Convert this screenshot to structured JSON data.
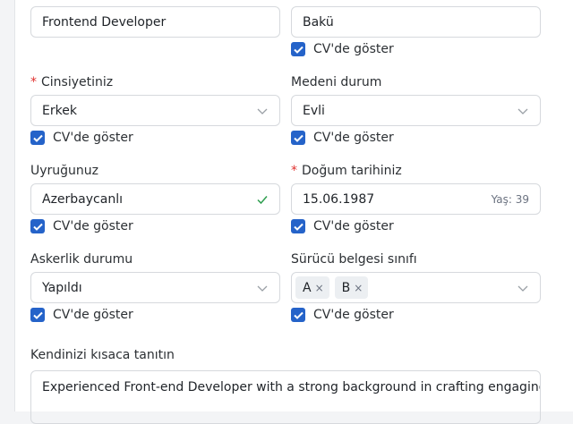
{
  "row1": {
    "left": {
      "value": "Frontend Developer"
    },
    "right": {
      "value": "Bakü",
      "show_cv": "CV'de göster"
    }
  },
  "gender": {
    "label": "Cinsiyetiniz",
    "required_mark": "*",
    "value": "Erkek",
    "show_cv": "CV'de göster"
  },
  "marital": {
    "label": "Medeni durum",
    "value": "Evli",
    "show_cv": "CV'de göster"
  },
  "nationality": {
    "label": "Uyruğunuz",
    "value": "Azerbaycanlı",
    "show_cv": "CV'de göster"
  },
  "birthdate": {
    "label": "Doğum tarihiniz",
    "required_mark": "*",
    "value": "15.06.1987",
    "age": "Yaş: 39",
    "show_cv": "CV'de göster"
  },
  "military": {
    "label": "Askerlik durumu",
    "value": "Yapıldı",
    "show_cv": "CV'de göster"
  },
  "license": {
    "label": "Sürücü belgesi sınıfı",
    "tags": [
      "A",
      "B"
    ],
    "tag_remove": "×",
    "show_cv": "CV'de göster"
  },
  "about": {
    "label": "Kendinizi kısaca tanıtın",
    "value": "Experienced Front-end Developer with a strong background in crafting engaging"
  },
  "colors": {
    "accent": "#2563c9",
    "required": "#e0312f",
    "success": "#2e9e4f",
    "border": "#d6d9dd"
  },
  "icons": [
    "chevron-down-icon",
    "checkmark-icon",
    "checkbox-checked-icon",
    "remove-tag-icon"
  ]
}
